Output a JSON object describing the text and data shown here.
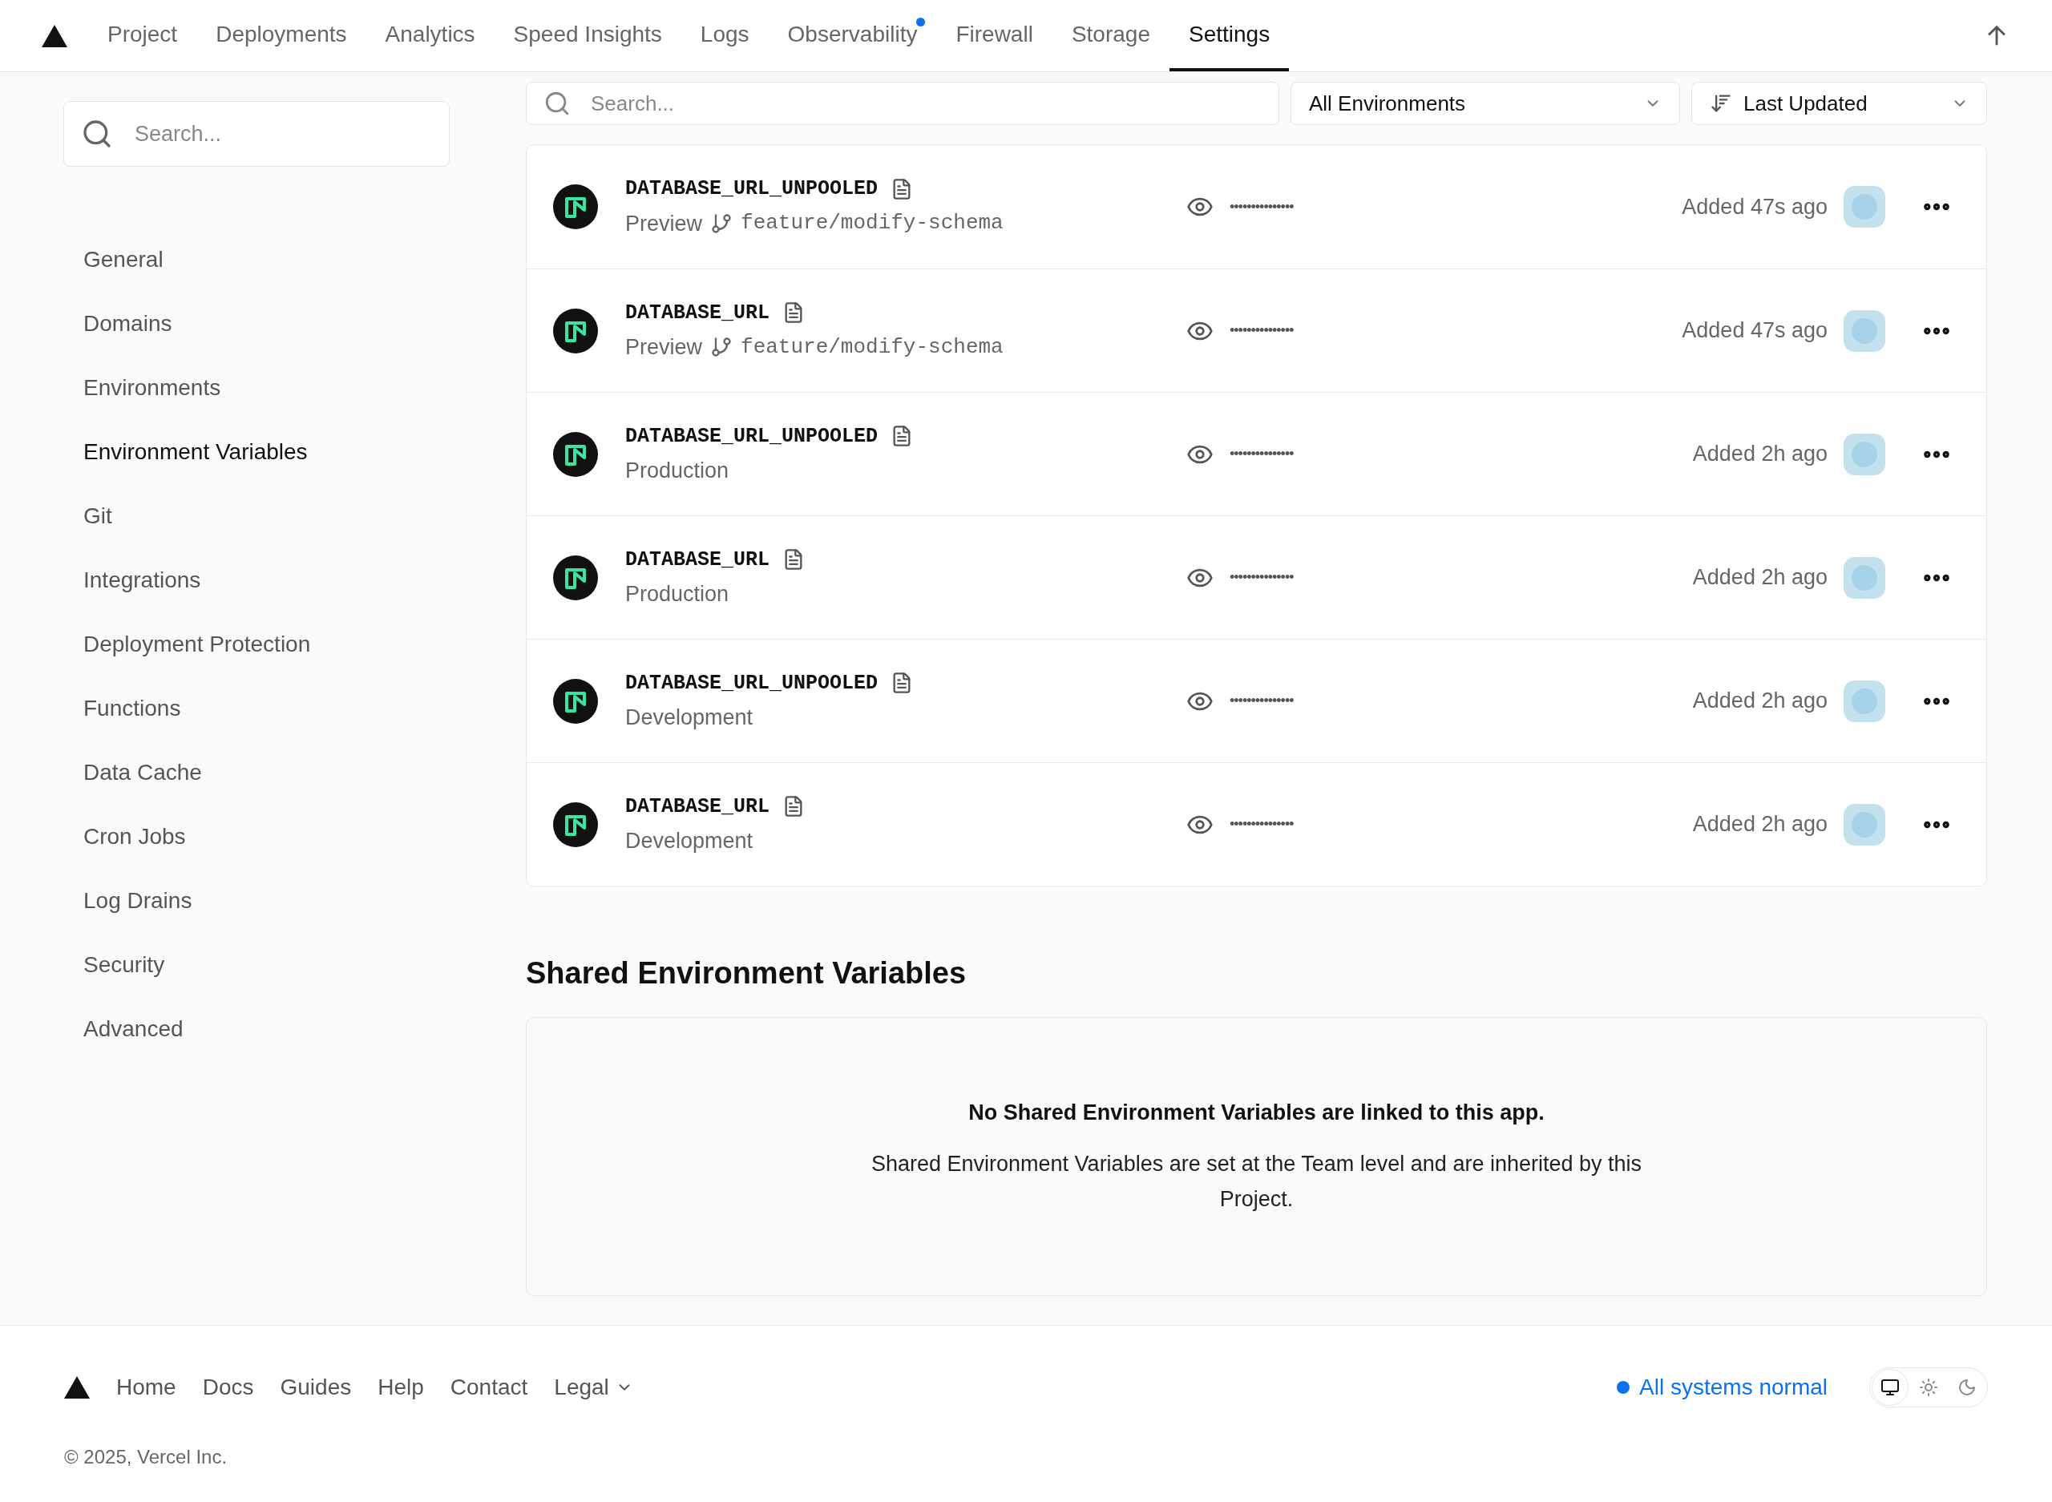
{
  "nav": {
    "tabs": [
      {
        "label": "Project",
        "selected": false,
        "dot": false
      },
      {
        "label": "Deployments",
        "selected": false,
        "dot": false
      },
      {
        "label": "Analytics",
        "selected": false,
        "dot": false
      },
      {
        "label": "Speed Insights",
        "selected": false,
        "dot": false
      },
      {
        "label": "Logs",
        "selected": false,
        "dot": false
      },
      {
        "label": "Observability",
        "selected": false,
        "dot": true
      },
      {
        "label": "Firewall",
        "selected": false,
        "dot": false
      },
      {
        "label": "Storage",
        "selected": false,
        "dot": false
      },
      {
        "label": "Settings",
        "selected": true,
        "dot": false
      }
    ]
  },
  "sidebar": {
    "search": {
      "placeholder": "Search..."
    },
    "items": [
      {
        "label": "General",
        "selected": false
      },
      {
        "label": "Domains",
        "selected": false
      },
      {
        "label": "Environments",
        "selected": false
      },
      {
        "label": "Environment Variables",
        "selected": true
      },
      {
        "label": "Git",
        "selected": false
      },
      {
        "label": "Integrations",
        "selected": false
      },
      {
        "label": "Deployment Protection",
        "selected": false
      },
      {
        "label": "Functions",
        "selected": false
      },
      {
        "label": "Data Cache",
        "selected": false
      },
      {
        "label": "Cron Jobs",
        "selected": false
      },
      {
        "label": "Log Drains",
        "selected": false
      },
      {
        "label": "Security",
        "selected": false
      },
      {
        "label": "Advanced",
        "selected": false
      }
    ]
  },
  "filters": {
    "search": {
      "placeholder": "Search..."
    },
    "environment": "All Environments",
    "sort": "Last Updated"
  },
  "variables": [
    {
      "name": "DATABASE_URL_UNPOOLED",
      "environment": "Preview",
      "branch": "feature/modify-schema",
      "value": "•••••••••••••••",
      "added": "Added 47s ago"
    },
    {
      "name": "DATABASE_URL",
      "environment": "Preview",
      "branch": "feature/modify-schema",
      "value": "•••••••••••••••",
      "added": "Added 47s ago"
    },
    {
      "name": "DATABASE_URL_UNPOOLED",
      "environment": "Production",
      "value": "•••••••••••••••",
      "added": "Added 2h ago"
    },
    {
      "name": "DATABASE_URL",
      "environment": "Production",
      "value": "•••••••••••••••",
      "added": "Added 2h ago"
    },
    {
      "name": "DATABASE_URL_UNPOOLED",
      "environment": "Development",
      "value": "•••••••••••••••",
      "added": "Added 2h ago"
    },
    {
      "name": "DATABASE_URL",
      "environment": "Development",
      "value": "•••••••••••••••",
      "added": "Added 2h ago"
    }
  ],
  "shared": {
    "title": "Shared Environment Variables",
    "empty_title": "No Shared Environment Variables are linked to this app.",
    "empty_text": "Shared Environment Variables are set at the Team level and are inherited by this Project."
  },
  "footer": {
    "links": [
      "Home",
      "Docs",
      "Guides",
      "Help",
      "Contact"
    ],
    "legal": "Legal",
    "status": "All systems normal",
    "copyright": "© 2025, Vercel Inc.",
    "theme": [
      {
        "kind": "system",
        "selected": true
      },
      {
        "kind": "light",
        "selected": false
      },
      {
        "kind": "dark",
        "selected": false
      }
    ]
  }
}
